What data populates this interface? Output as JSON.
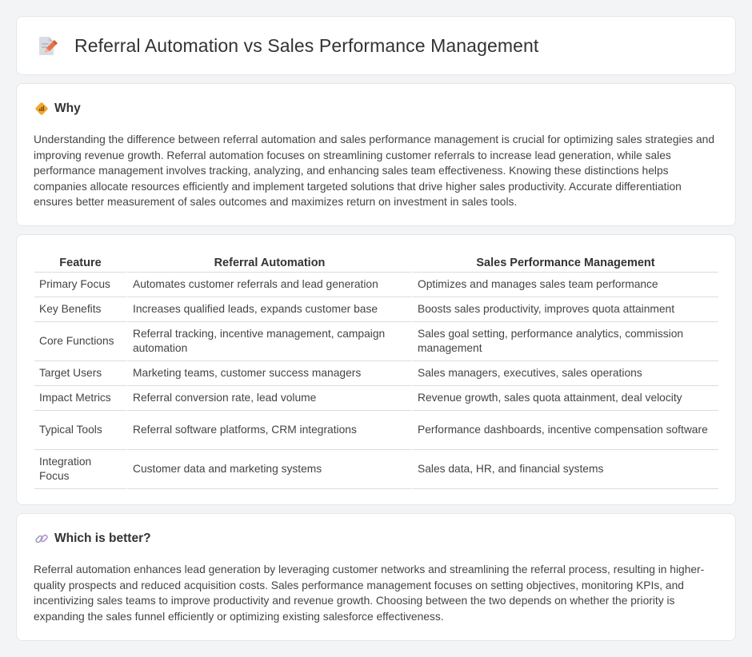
{
  "header": {
    "title": "Referral Automation vs Sales Performance Management",
    "icon": "document-pencil-icon"
  },
  "why": {
    "icon": "diamond-signal-icon",
    "heading": "Why",
    "text": "Understanding the difference between referral automation and sales performance management is crucial for optimizing sales strategies and improving revenue growth. Referral automation focuses on streamlining customer referrals to increase lead generation, while sales performance management involves tracking, analyzing, and enhancing sales team effectiveness. Knowing these distinctions helps companies allocate resources efficiently and implement targeted solutions that drive higher sales productivity. Accurate differentiation ensures better measurement of sales outcomes and maximizes return on investment in sales tools."
  },
  "table": {
    "headers": [
      "Feature",
      "Referral Automation",
      "Sales Performance Management"
    ],
    "rows": [
      [
        "Primary Focus",
        "Automates customer referrals and lead generation",
        "Optimizes and manages sales team performance"
      ],
      [
        "Key Benefits",
        "Increases qualified leads, expands customer base",
        "Boosts sales productivity, improves quota attainment"
      ],
      [
        "Core Functions",
        "Referral tracking, incentive management, campaign automation",
        "Sales goal setting, performance analytics, commission management"
      ],
      [
        "Target Users",
        "Marketing teams, customer success managers",
        "Sales managers, executives, sales operations"
      ],
      [
        "Impact Metrics",
        "Referral conversion rate, lead volume",
        "Revenue growth, sales quota attainment, deal velocity"
      ],
      [
        "Typical Tools",
        "Referral software platforms, CRM integrations",
        "Performance dashboards, incentive compensation software"
      ],
      [
        "Integration Focus",
        "Customer data and marketing systems",
        "Sales data, HR, and financial systems"
      ]
    ]
  },
  "better": {
    "icon": "link-icon",
    "heading": "Which is better?",
    "text": "Referral automation enhances lead generation by leveraging customer networks and streamlining the referral process, resulting in higher-quality prospects and reduced acquisition costs. Sales performance management focuses on setting objectives, monitoring KPIs, and incentivizing sales teams to improve productivity and revenue growth. Choosing between the two depends on whether the priority is expanding the sales funnel efficiently or optimizing existing salesforce effectiveness."
  },
  "colors": {
    "page_bg": "#f3f4f6",
    "card_bg": "#ffffff",
    "icon_accent": "#e8734a",
    "diamond_accent": "#f0a830"
  }
}
